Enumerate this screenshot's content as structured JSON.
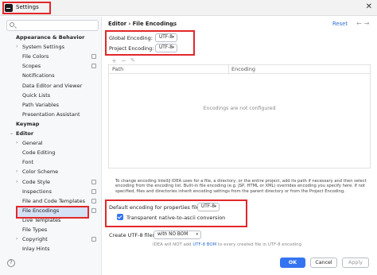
{
  "window": {
    "title": "Settings",
    "close_glyph": "✕"
  },
  "search": {
    "glyph": "Q",
    "placeholder": ""
  },
  "sidebar": {
    "items": [
      {
        "label": "Appearance & Behavior",
        "bold": true,
        "chevron": "",
        "indent": 0,
        "proj": false
      },
      {
        "label": "System Settings",
        "bold": false,
        "chevron": "›",
        "indent": 1,
        "proj": false
      },
      {
        "label": "File Colors",
        "bold": false,
        "chevron": "",
        "indent": 1,
        "proj": true
      },
      {
        "label": "Scopes",
        "bold": false,
        "chevron": "",
        "indent": 1,
        "proj": true
      },
      {
        "label": "Notifications",
        "bold": false,
        "chevron": "",
        "indent": 1,
        "proj": false
      },
      {
        "label": "Data Editor and Viewer",
        "bold": false,
        "chevron": "",
        "indent": 1,
        "proj": false
      },
      {
        "label": "Quick Lists",
        "bold": false,
        "chevron": "",
        "indent": 1,
        "proj": false
      },
      {
        "label": "Path Variables",
        "bold": false,
        "chevron": "",
        "indent": 1,
        "proj": false
      },
      {
        "label": "Presentation Assistant",
        "bold": false,
        "chevron": "",
        "indent": 1,
        "proj": false
      },
      {
        "label": "Keymap",
        "bold": true,
        "chevron": "",
        "indent": 0,
        "proj": false
      },
      {
        "label": "Editor",
        "bold": true,
        "chevron": "⌄",
        "indent": 0,
        "proj": false
      },
      {
        "label": "General",
        "bold": false,
        "chevron": "›",
        "indent": 1,
        "proj": false
      },
      {
        "label": "Code Editing",
        "bold": false,
        "chevron": "",
        "indent": 1,
        "proj": false
      },
      {
        "label": "Font",
        "bold": false,
        "chevron": "",
        "indent": 1,
        "proj": false
      },
      {
        "label": "Color Scheme",
        "bold": false,
        "chevron": "›",
        "indent": 1,
        "proj": false
      },
      {
        "label": "Code Style",
        "bold": false,
        "chevron": "›",
        "indent": 1,
        "proj": true
      },
      {
        "label": "Inspections",
        "bold": false,
        "chevron": "",
        "indent": 1,
        "proj": true
      },
      {
        "label": "File and Code Templates",
        "bold": false,
        "chevron": "",
        "indent": 1,
        "proj": true
      },
      {
        "label": "File Encodings",
        "bold": false,
        "chevron": "",
        "indent": 1,
        "proj": true,
        "selected": true
      },
      {
        "label": "Live Templates",
        "bold": false,
        "chevron": "",
        "indent": 1,
        "proj": false
      },
      {
        "label": "File Types",
        "bold": false,
        "chevron": "",
        "indent": 1,
        "proj": false
      },
      {
        "label": "Copyright",
        "bold": false,
        "chevron": "›",
        "indent": 1,
        "proj": true
      },
      {
        "label": "Inlay Hints",
        "bold": false,
        "chevron": "",
        "indent": 1,
        "proj": false
      }
    ]
  },
  "header": {
    "breadcrumb": "Editor  ›  File Encodings",
    "reset": "Reset",
    "back": "←",
    "forward": "→"
  },
  "encoding": {
    "global_label": "Global Encoding:",
    "global_value": "UTF-8",
    "project_label": "Project Encoding:",
    "project_value": "UTF-8",
    "dropdown_arrow": "▾"
  },
  "table_toolbar": {
    "add": "+",
    "remove": "−",
    "edit": "✎"
  },
  "table": {
    "columns": [
      "Path",
      "Encoding"
    ],
    "empty_text": "Encodings are not configured"
  },
  "description": "To change encoding IntelliJ IDEA uses for a file, a directory, or the entire project, add its path if necessary and then select encoding from the encoding list. Built-in file encoding (e.g. JSP, HTML or XML) overrides encoding you specify here. If not specified, files and directories inherit encoding settings from the parent directory or from the Project Encoding.",
  "properties": {
    "label": "Default encoding for properties files:",
    "value": "UTF-8",
    "checkbox_label": "Transparent native-to-ascii conversion",
    "checked": true
  },
  "bom": {
    "label": "Create UTF-8 files:",
    "value": "with NO BOM",
    "note_prefix": "IDEA will NOT add ",
    "note_link": "UTF-8 BOM",
    "note_suffix": " to every created file in UTF-8 encoding"
  },
  "footer": {
    "help": "?",
    "ok": "OK",
    "cancel": "Cancel",
    "apply": "Apply"
  },
  "colors": {
    "accent": "#3574f0",
    "link": "#2f6fd6",
    "highlight_box": "#e3272b",
    "selection": "#d5e1f5"
  }
}
